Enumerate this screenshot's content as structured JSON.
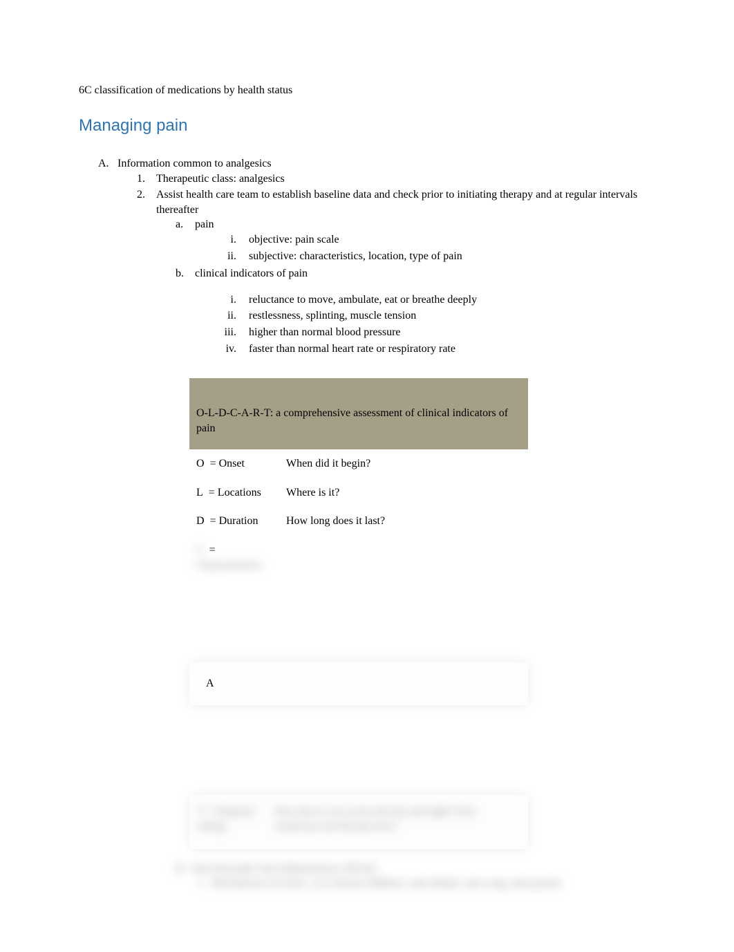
{
  "subtitle": "6C classification of medications by health status",
  "heading": "Managing pain",
  "outline": {
    "A": {
      "marker": "A.",
      "text": "Information common to analgesics",
      "items": [
        {
          "marker": "1.",
          "text": "Therapeutic class: analgesics"
        },
        {
          "marker": "2.",
          "text": "Assist health care team to establish baseline data and check prior to initiating therapy and at regular intervals thereafter",
          "subs": [
            {
              "marker": "a.",
              "text": "pain",
              "subs": [
                {
                  "marker": "i.",
                  "text": "objective: pain scale"
                },
                {
                  "marker": "ii.",
                  "text": "subjective: characteristics, location, type of pain"
                }
              ]
            },
            {
              "marker": "b.",
              "text": "clinical indicators of pain",
              "subs": [
                {
                  "marker": "i.",
                  "text": "reluctance to move, ambulate, eat or breathe deeply"
                },
                {
                  "marker": "ii.",
                  "text": "restlessness, splinting, muscle tension"
                },
                {
                  "marker": "iii.",
                  "text": "higher than normal blood pressure"
                },
                {
                  "marker": "iv.",
                  "text": "faster than normal heart rate or respiratory rate"
                }
              ]
            }
          ]
        }
      ]
    }
  },
  "table": {
    "header": "O-L-D-C-A-R-T: a comprehensive assessment of clinical indicators of pain",
    "rows": [
      {
        "letter": "O",
        "term": "= Onset",
        "question": "When did it begin?"
      },
      {
        "letter": "L",
        "term": "= Locations",
        "question": "Where is it?"
      },
      {
        "letter": "D",
        "term": "= Duration",
        "question": "How long does it last?"
      },
      {
        "letter": "",
        "term": "=",
        "question": ""
      },
      {
        "letter": "A",
        "term": "",
        "question": ""
      }
    ]
  }
}
